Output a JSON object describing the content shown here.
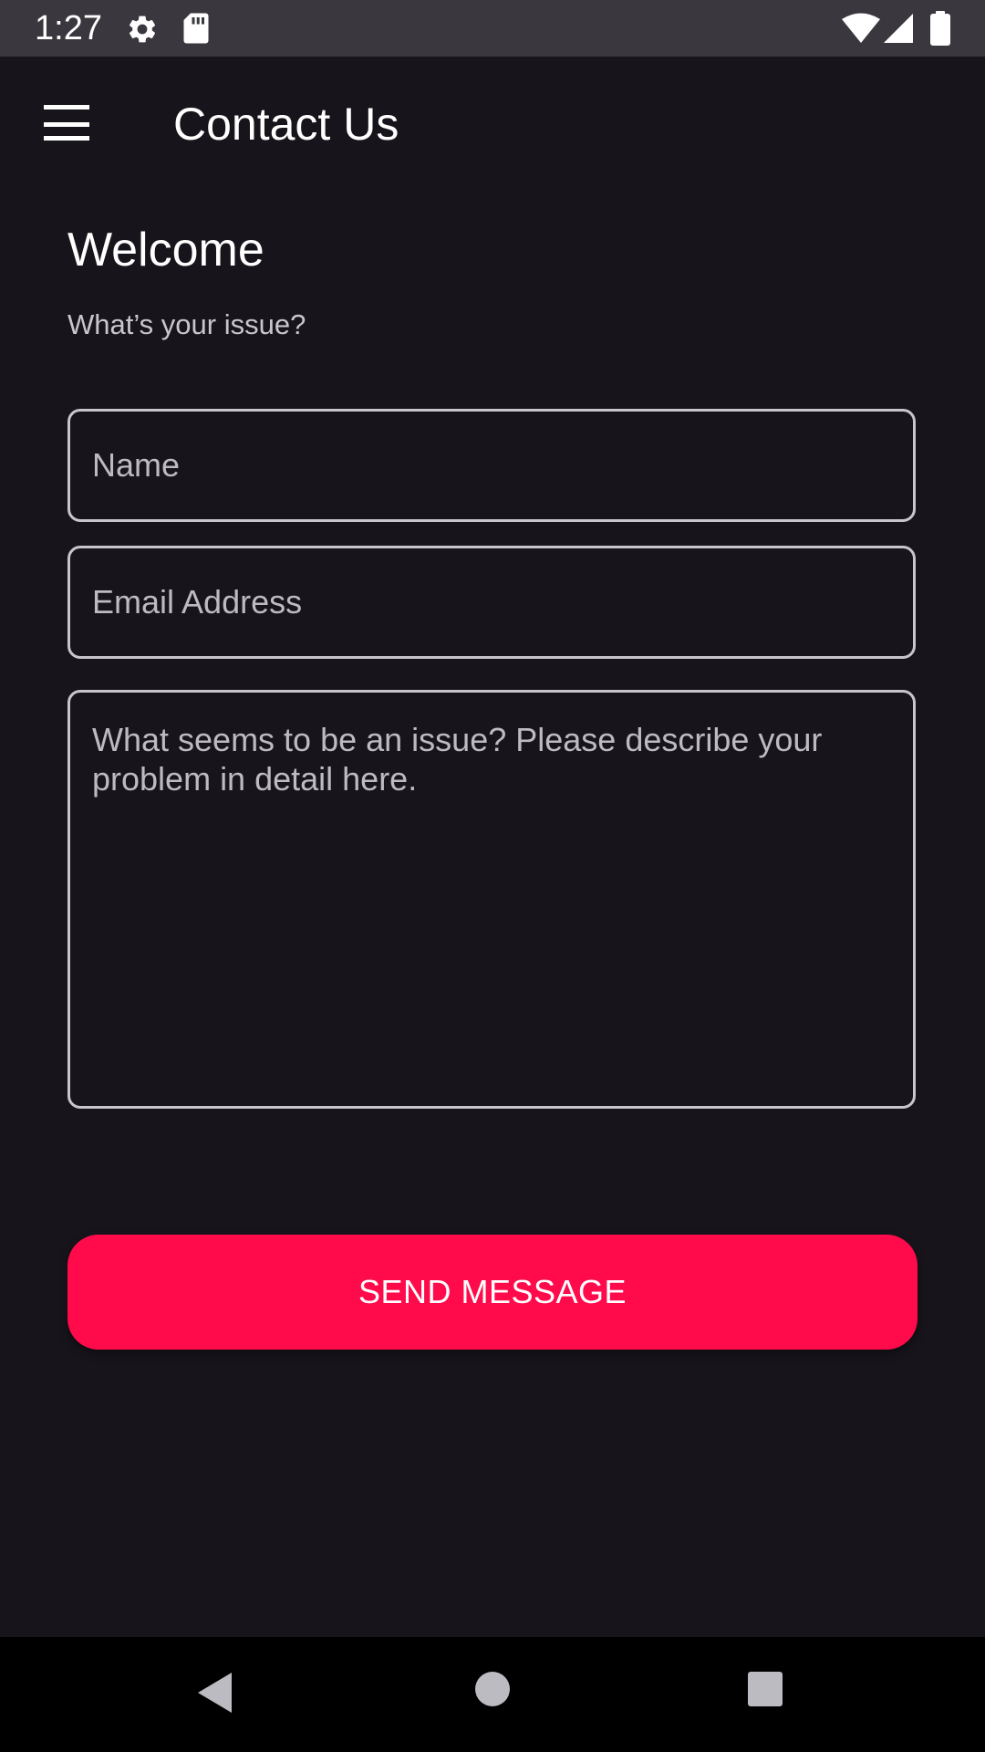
{
  "status_bar": {
    "time": "1:27",
    "icons": [
      "gear-icon",
      "sd-card-icon",
      "wifi-icon",
      "signal-icon",
      "battery-icon"
    ]
  },
  "app_bar": {
    "title": "Contact Us",
    "menu_icon": "hamburger-menu-icon"
  },
  "main": {
    "welcome_title": "Welcome",
    "subtitle": "What’s your issue?",
    "name_field": {
      "value": "",
      "placeholder": "Name"
    },
    "email_field": {
      "value": "",
      "placeholder": "Email Address"
    },
    "issue_field": {
      "value": "",
      "placeholder": "What seems to be an issue? Please describe your problem in detail here."
    },
    "send_button_label": "SEND MESSAGE"
  },
  "nav_bar": {
    "icons": [
      "back-icon",
      "home-icon",
      "recents-icon"
    ]
  },
  "colors": {
    "background": "#17151b",
    "status_bar": "#3a383e",
    "accent": "#ff0a4b",
    "field_border": "#c8c6cc",
    "nav_bar": "#000000"
  }
}
